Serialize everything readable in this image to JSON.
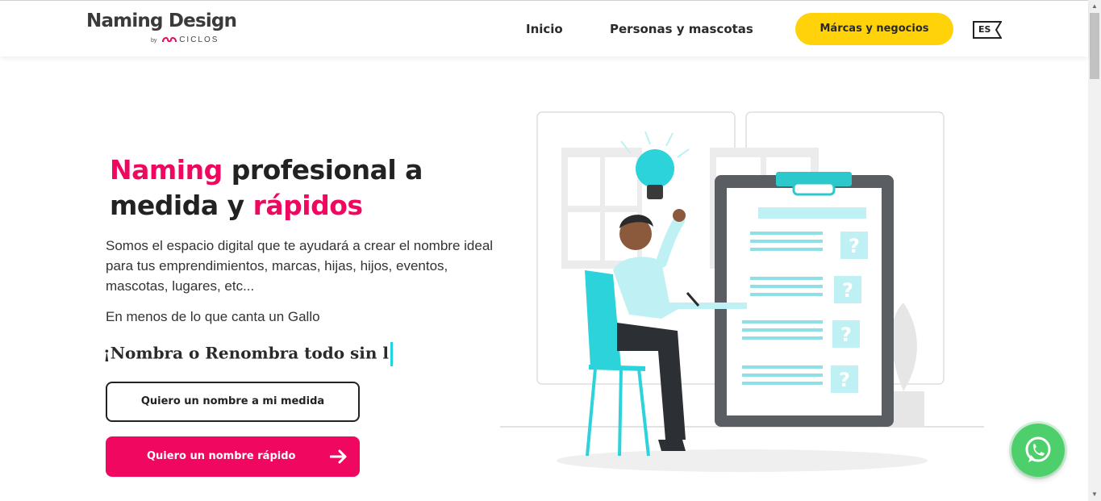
{
  "header": {
    "logo_title": "Naming Design",
    "logo_by": "by",
    "logo_sub": "CICLOS",
    "nav": [
      {
        "label": "Inicio"
      },
      {
        "label": "Personas y mascotas"
      }
    ],
    "cta_label": "Márcas y negocios",
    "lang": "ES"
  },
  "hero": {
    "title_part1": "Naming",
    "title_part2": " profesional a medida y ",
    "title_part3": "rápidos",
    "description": "Somos el espacio digital que te ayudará a crear el nombre ideal para tus emprendimientos, marcas, hijas, hijos, eventos, mascotas, lugares, etc...",
    "tagline": "En menos de lo que canta un Gallo",
    "typing_text": "¡Nombra o Renombra todo sin l",
    "button_outline": "Quiero un nombre a mi medida",
    "button_solid": "Quiero un nombre rápido",
    "illustration_marks": [
      "?",
      "?",
      "?",
      "?"
    ]
  },
  "colors": {
    "brand_pink": "#f0075f",
    "cta_yellow": "#ffd20a",
    "accent_cyan": "#22d3e0",
    "whatsapp_green": "#4dd06b"
  }
}
